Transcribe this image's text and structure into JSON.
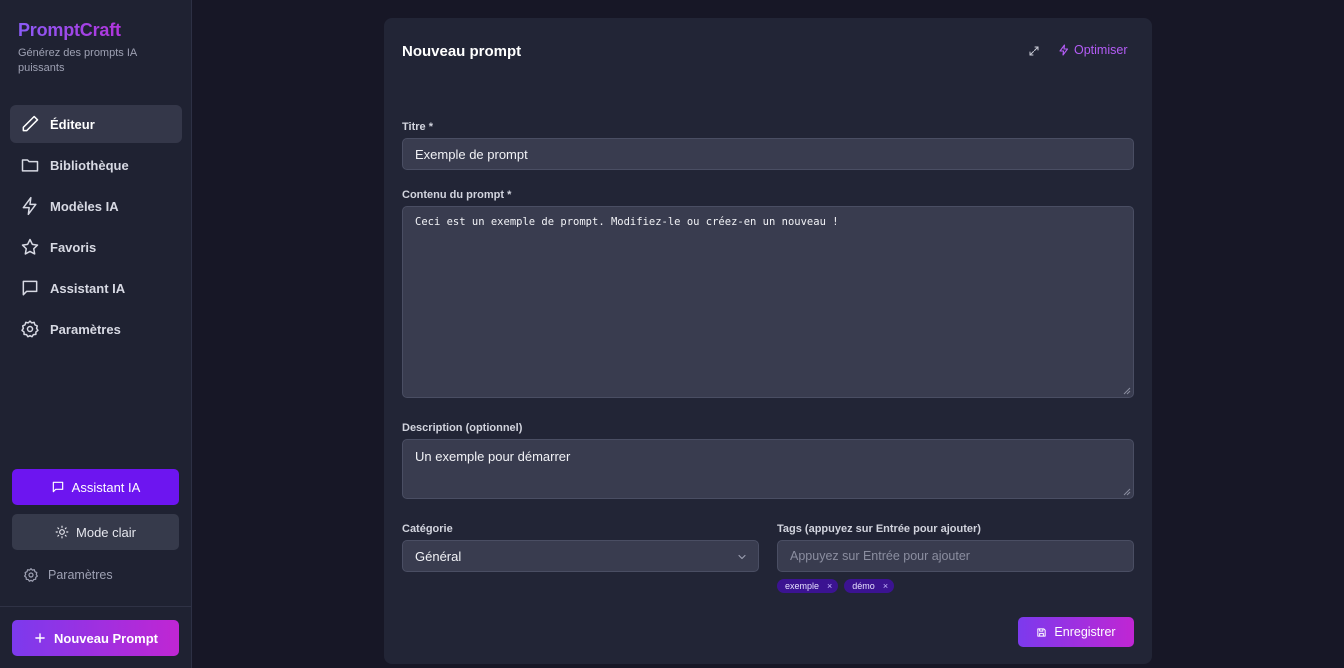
{
  "brand": {
    "name": "PromptCraft",
    "tagline": "Générez des prompts IA puissants"
  },
  "sidebar": {
    "items": [
      {
        "label": "Éditeur",
        "icon": "pencil-icon",
        "active": true
      },
      {
        "label": "Bibliothèque",
        "icon": "folder-icon"
      },
      {
        "label": "Modèles IA",
        "icon": "lightning-icon"
      },
      {
        "label": "Favoris",
        "icon": "star-icon"
      },
      {
        "label": "Assistant IA",
        "icon": "chat-icon"
      },
      {
        "label": "Paramètres",
        "icon": "gear-icon"
      }
    ],
    "assistant_button": "Assistant IA",
    "mode_button": "Mode clair",
    "settings_link": "Paramètres",
    "new_prompt_button": "Nouveau Prompt"
  },
  "editor": {
    "title": "Nouveau prompt",
    "optimize_label": "Optimiser",
    "title_label": "Titre *",
    "title_value": "Exemple de prompt",
    "content_label": "Contenu du prompt *",
    "content_value": "Ceci est un exemple de prompt. Modifiez-le ou créez-en un nouveau !",
    "description_label": "Description (optionnel)",
    "description_value": "Un exemple pour démarrer",
    "category_label": "Catégorie",
    "category_value": "Général",
    "tags_label": "Tags (appuyez sur Entrée pour ajouter)",
    "tags_placeholder": "Appuyez sur Entrée pour ajouter",
    "tags": [
      "exemple",
      "démo"
    ],
    "save_label": "Enregistrer"
  },
  "colors": {
    "accent": "#7c3aed",
    "accent_end": "#c026d3",
    "background": "#171726",
    "card": "#222536"
  }
}
